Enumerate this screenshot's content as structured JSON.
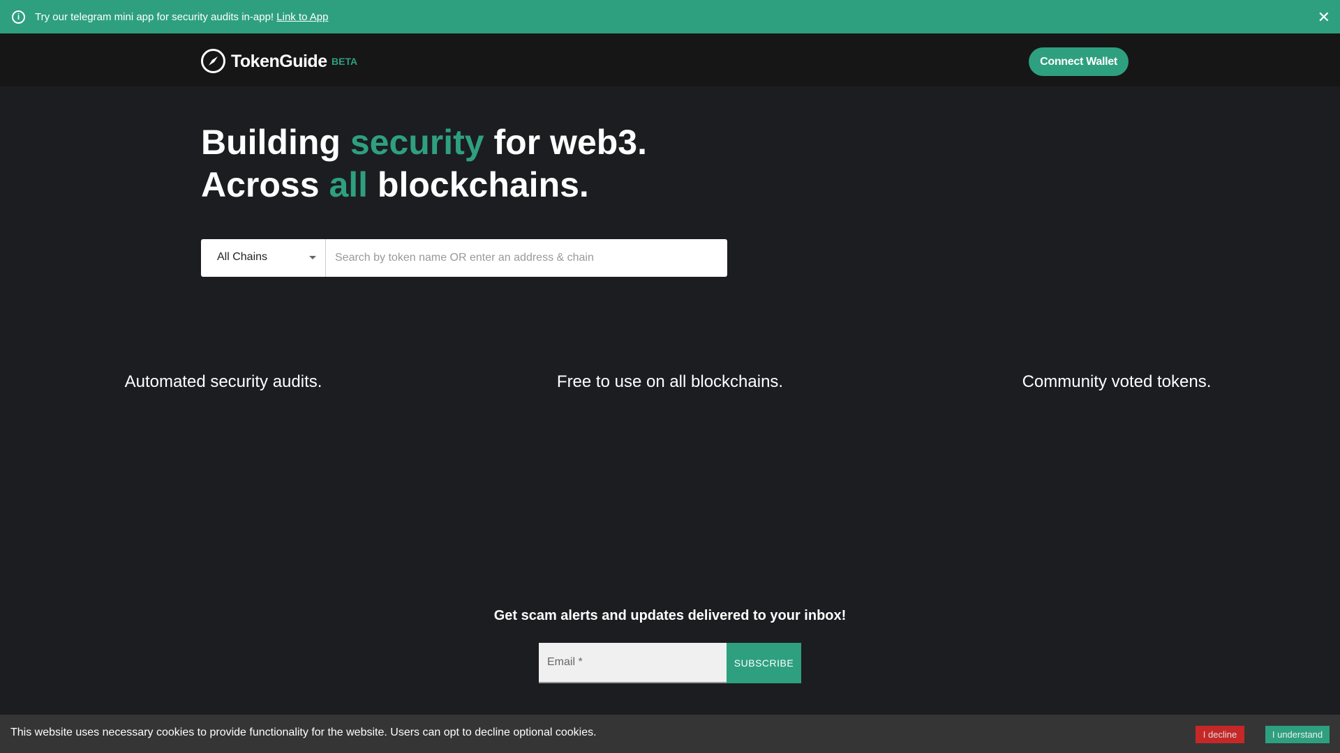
{
  "banner": {
    "message": "Try our telegram mini app for security audits in-app!",
    "link": "Link to App",
    "icon": "info-icon",
    "close_icon": "close-icon"
  },
  "header": {
    "logo": "TokenGuide",
    "badge": "BETA",
    "connect": "Connect Wallet"
  },
  "hero": {
    "l1a": "Building ",
    "l1b": "security",
    "l1c": " for web3.",
    "l2a": "Across ",
    "l2b": "all",
    "l2c": " blockchains."
  },
  "search": {
    "chain": "All Chains",
    "placeholder": "Search by token name OR enter an address & chain"
  },
  "features": [
    "Automated security audits.",
    "Free to use on all blockchains.",
    "Community voted tokens."
  ],
  "newsletter": {
    "title": "Get scam alerts and updates delivered to your inbox!",
    "email_label": "Email *",
    "subscribe": "SUBSCRIBE"
  },
  "cookie": {
    "text": "This website uses necessary cookies to provide functionality for the website. Users can opt to decline optional cookies.",
    "decline": "I decline",
    "accept": "I understand"
  },
  "colors": {
    "accent": "#2ea07f",
    "decline": "#c62828",
    "background": "#1c1d21"
  }
}
